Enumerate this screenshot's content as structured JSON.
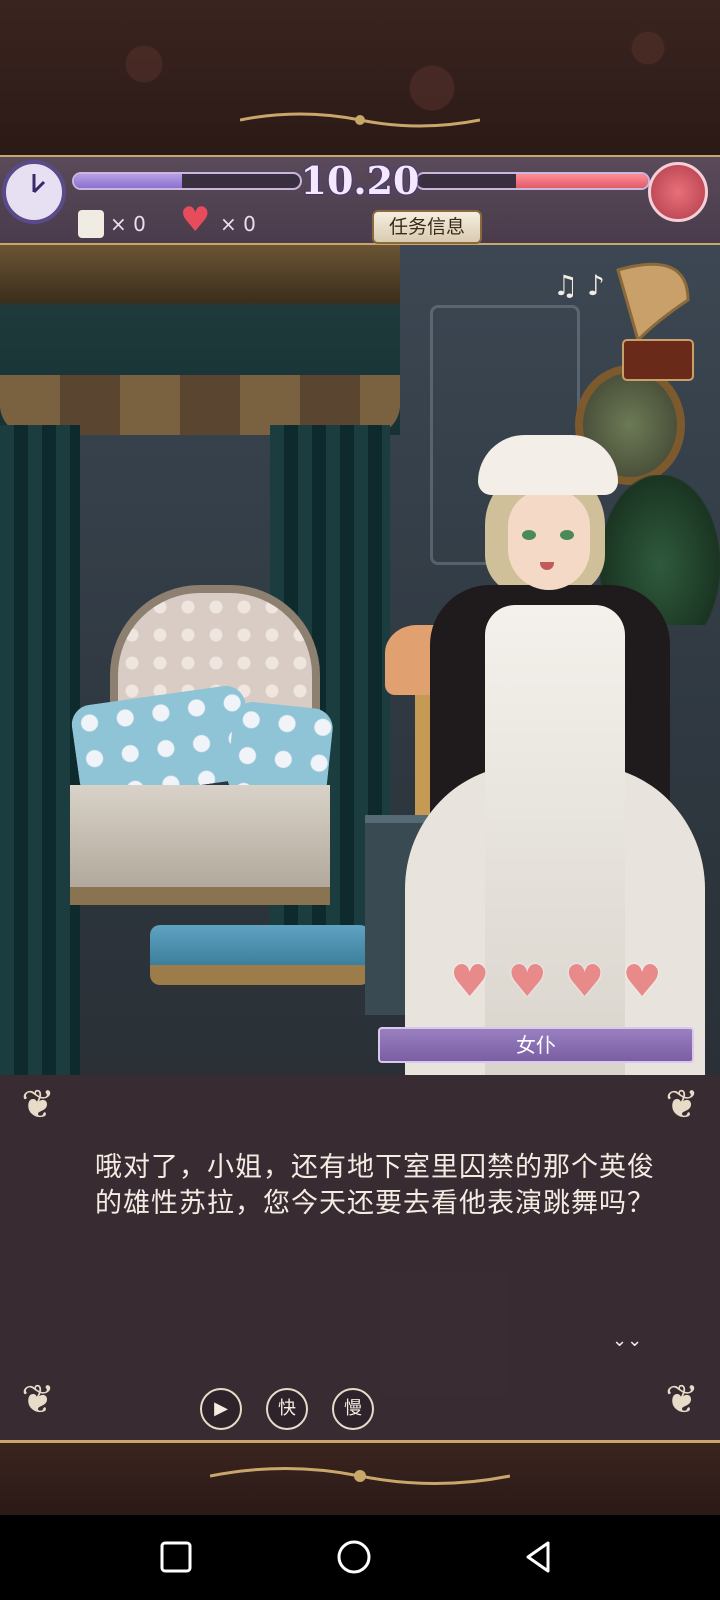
{
  "hud": {
    "time": "10.20",
    "timer_left_fraction": 0.48,
    "timer_right_fraction": 0.57,
    "scroll_count": "× 0",
    "heart_count": "× 0",
    "task_button_label": "任务信息",
    "icons": [
      "clock-icon",
      "rose-icon",
      "scroll-icon",
      "heart-icon",
      "gramophone-icon"
    ]
  },
  "scene": {
    "affection_hearts": 4
  },
  "dialog": {
    "speaker": "女仆",
    "text": "哦对了，小姐，还有地下室里囚禁的那个英俊的雄性苏拉，您今天还要去看他表演跳舞吗？"
  },
  "controls": {
    "auto_label": "",
    "fast_label": "快",
    "slow_label": "慢"
  },
  "colors": {
    "accent_purple": "#8c6fcf",
    "accent_red": "#e35a68",
    "frame_gold": "#c9a76a"
  }
}
